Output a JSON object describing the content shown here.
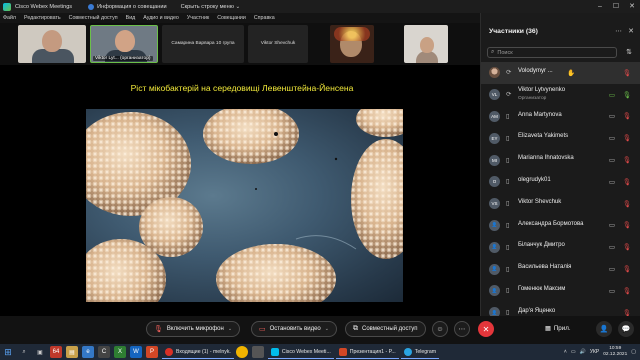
{
  "titlebar": {
    "app_name": "Cisco Webex Meetings",
    "info_label": "Информация о совещании",
    "hide_menu_label": "Скрыть строку меню",
    "chevron": "⌄"
  },
  "menubar": [
    "Файл",
    "Редактировать",
    "Совместный доступ",
    "Вид",
    "Аудио и видео",
    "Участник",
    "Совещании",
    "Справка"
  ],
  "thumbnails": [
    {
      "name": ""
    },
    {
      "name": "Viktor Lyt...",
      "role": "(организатор)"
    },
    {
      "name": "Самарина Варвара 10 група"
    },
    {
      "name": "Viktor Shevchuk"
    },
    {
      "name": ""
    },
    {
      "name": ""
    }
  ],
  "slide": {
    "title": "Ріст мікобактерій на середовищі Левенштейна-Йенсена"
  },
  "controls": {
    "unmute_label": "Включить микрофон",
    "stop_video_label": "Остановить видео",
    "share_label": "Совместный доступ",
    "apps_label": "Прил."
  },
  "participants_panel": {
    "title": "Участники (36)",
    "search_placeholder": "Поиск",
    "participants": [
      {
        "name": "Volodymyr ...",
        "initials": "",
        "photo": true,
        "device": "phone-sync-icon",
        "role": "",
        "hand": true,
        "camera": false,
        "camera_on": false
      },
      {
        "name": "Viktor Lytvynenko",
        "initials": "VL",
        "photo": false,
        "device": "phone-sync-icon",
        "role": "Организатор",
        "hand": false,
        "camera": true,
        "camera_on": true
      },
      {
        "name": "Anna Martynova",
        "initials": "AM",
        "photo": false,
        "device": "mobile-icon",
        "role": "",
        "hand": false,
        "camera": true,
        "camera_on": false
      },
      {
        "name": "Elizaveta Yakimets",
        "initials": "EY",
        "photo": false,
        "device": "mobile-icon",
        "role": "",
        "hand": false,
        "camera": true,
        "camera_on": false
      },
      {
        "name": "Marianna Ihnatovska",
        "initials": "MI",
        "photo": false,
        "device": "mobile-icon",
        "role": "",
        "hand": false,
        "camera": true,
        "camera_on": false
      },
      {
        "name": "olegrudyk01",
        "initials": "O",
        "photo": false,
        "device": "mobile-icon",
        "role": "",
        "hand": false,
        "camera": true,
        "camera_on": false
      },
      {
        "name": "Viktor Shevchuk",
        "initials": "VS",
        "photo": false,
        "device": "mobile-icon",
        "role": "",
        "hand": false,
        "camera": false,
        "camera_on": false
      },
      {
        "name": "Александра Бормотова",
        "initials": "",
        "photo": false,
        "device": "mobile-icon",
        "role": "",
        "hand": false,
        "camera": true,
        "camera_on": false
      },
      {
        "name": "Біланчук Дмитро",
        "initials": "",
        "photo": false,
        "device": "mobile-icon",
        "role": "",
        "hand": false,
        "camera": true,
        "camera_on": false
      },
      {
        "name": "Васильева Наталія",
        "initials": "",
        "photo": false,
        "device": "mobile-icon",
        "role": "",
        "hand": false,
        "camera": true,
        "camera_on": false
      },
      {
        "name": "Гоменюк Максим",
        "initials": "",
        "photo": false,
        "device": "mobile-icon",
        "role": "",
        "hand": false,
        "camera": true,
        "camera_on": false
      },
      {
        "name": "Дар'я Яценко",
        "initials": "",
        "photo": false,
        "device": "mobile-icon",
        "role": "",
        "hand": false,
        "camera": false,
        "camera_on": false
      }
    ]
  },
  "taskbar": {
    "tasks": [
      {
        "label": "Входящие (1) - melnyk.",
        "color": "#d93025"
      },
      {
        "label": "Cisco Webex Meeti...",
        "color": "#00bceb"
      },
      {
        "label": "Презентация1 - P...",
        "color": "#d24726"
      },
      {
        "label": "Telegram",
        "color": "#2aa4e1"
      }
    ],
    "lang": "УКР",
    "time": "10:59",
    "date": "02.12.2021"
  },
  "colors": {
    "title_yellow": "#f2ea3a",
    "end_red": "#e4363b",
    "muted_red": "#e84b4b",
    "camera_green": "#6cc04a"
  }
}
